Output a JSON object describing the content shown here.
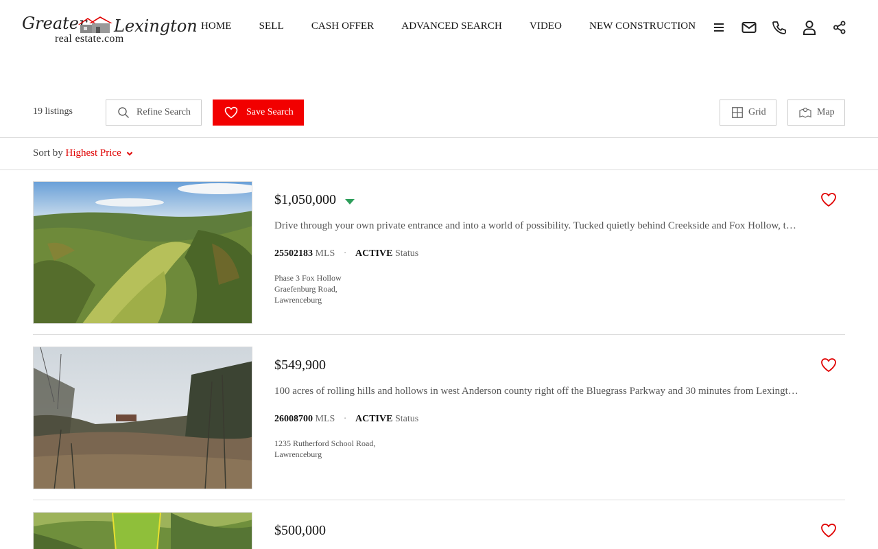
{
  "header": {
    "logo": {
      "word1": "Greater",
      "word2": "Lexington",
      "word3": "real estate.com"
    },
    "nav": [
      "HOME",
      "SELL",
      "CASH OFFER",
      "ADVANCED SEARCH",
      "VIDEO",
      "NEW CONSTRUCTION"
    ],
    "icons": [
      "menu-icon",
      "mail-icon",
      "phone-icon",
      "user-icon",
      "share-icon"
    ]
  },
  "toolbar": {
    "count": "19 listings",
    "refine_label": "Refine Search",
    "save_label": "Save Search",
    "grid_label": "Grid",
    "map_label": "Map"
  },
  "sort": {
    "label": "Sort by",
    "value": "Highest Price"
  },
  "colors": {
    "accent": "#f20000",
    "price_down": "#2e9e5b"
  },
  "listings": [
    {
      "price": "$1,050,000",
      "price_indicator": "price-down-icon",
      "description": "Drive through your own private entrance and into a world of possibility. Tucked quietly behind Creekside and Fox Hollow, t…",
      "mls_number": "25502183",
      "mls_label": "MLS",
      "status": "ACTIVE",
      "status_label": "Status",
      "address": [
        "Phase 3 Fox Hollow",
        "Graefenburg Road,",
        "Lawrenceburg"
      ]
    },
    {
      "price": "$549,900",
      "description": "100 acres of rolling hills and hollows in west Anderson county right off the Bluegrass Parkway and 30 minutes from Lexingt…",
      "mls_number": "26008700",
      "mls_label": "MLS",
      "status": "ACTIVE",
      "status_label": "Status",
      "address": [
        "1235 Rutherford School Road,",
        "Lawrenceburg"
      ]
    },
    {
      "price": "$500,000"
    }
  ]
}
